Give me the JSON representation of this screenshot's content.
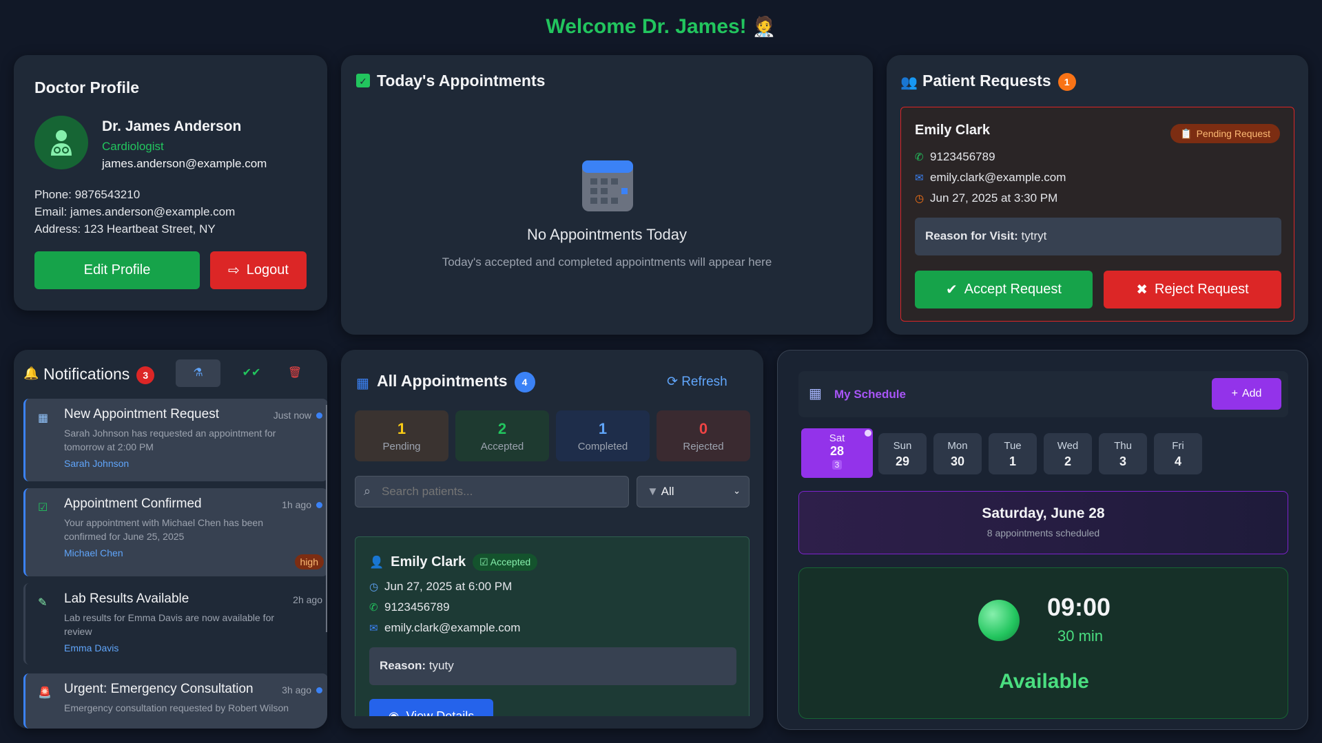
{
  "welcome": {
    "text": "Welcome Dr. James!",
    "emoji": "🧑‍⚕️"
  },
  "profile": {
    "title": "Doctor Profile",
    "name": "Dr. James Anderson",
    "specialty": "Cardiologist",
    "email_short": "james.anderson@example.com",
    "phone": "Phone: 9876543210",
    "email": "Email: james.anderson@example.com",
    "address": "Address: 123 Heartbeat Street, NY",
    "edit_label": "Edit Profile",
    "logout_label": "Logout"
  },
  "today": {
    "title": "Today's Appointments",
    "empty_title": "No Appointments Today",
    "empty_sub": "Today's accepted and completed appointments will appear here"
  },
  "requests": {
    "title": "Patient Requests",
    "count": "1",
    "patient": "Emily Clark",
    "status": "Pending Request",
    "phone": "9123456789",
    "email": "emily.clark@example.com",
    "datetime": "Jun 27, 2025 at 3:30 PM",
    "reason_label": "Reason for Visit:",
    "reason": "tytryt",
    "accept_label": "Accept Request",
    "reject_label": "Reject Request"
  },
  "notifications": {
    "title": "Notifications",
    "count": "3",
    "items": [
      {
        "title": "New Appointment Request",
        "time": "Just now",
        "body": "Sarah Johnson has requested an appointment for tomorrow at 2:00 PM",
        "who": "Sarah Johnson"
      },
      {
        "title": "Appointment Confirmed",
        "time": "1h ago",
        "body": "Your appointment with Michael Chen has been confirmed for June 25, 2025",
        "who": "Michael Chen",
        "priority": "high"
      },
      {
        "title": "Lab Results Available",
        "time": "2h ago",
        "body": "Lab results for Emma Davis are now available for review",
        "who": "Emma Davis"
      },
      {
        "title": "Urgent: Emergency Consultation",
        "time": "3h ago",
        "body": "Emergency consultation requested by Robert Wilson",
        "who": ""
      }
    ]
  },
  "all_appts": {
    "title": "All Appointments",
    "count": "4",
    "refresh_label": "Refresh",
    "stats": [
      {
        "n": "1",
        "label": "Pending"
      },
      {
        "n": "2",
        "label": "Accepted"
      },
      {
        "n": "1",
        "label": "Completed"
      },
      {
        "n": "0",
        "label": "Rejected"
      }
    ],
    "search_placeholder": "Search patients...",
    "filter_value": "All",
    "card": {
      "patient": "Emily Clark",
      "status": "Accepted",
      "datetime": "Jun 27, 2025 at 6:00 PM",
      "phone": "9123456789",
      "email": "emily.clark@example.com",
      "reason_label": "Reason:",
      "reason": "tyuty",
      "view_label": "View Details"
    }
  },
  "schedule": {
    "title": "My Schedule",
    "add_label": "Add",
    "days": [
      {
        "name": "Sat",
        "date": "28",
        "count": "3"
      },
      {
        "name": "Sun",
        "date": "29"
      },
      {
        "name": "Mon",
        "date": "30"
      },
      {
        "name": "Tue",
        "date": "1"
      },
      {
        "name": "Wed",
        "date": "2"
      },
      {
        "name": "Thu",
        "date": "3"
      },
      {
        "name": "Fri",
        "date": "4"
      }
    ],
    "selected_title": "Saturday, June 28",
    "selected_sub": "8 appointments scheduled",
    "slot_time": "09:00",
    "slot_duration": "30 min",
    "slot_status": "Available"
  }
}
